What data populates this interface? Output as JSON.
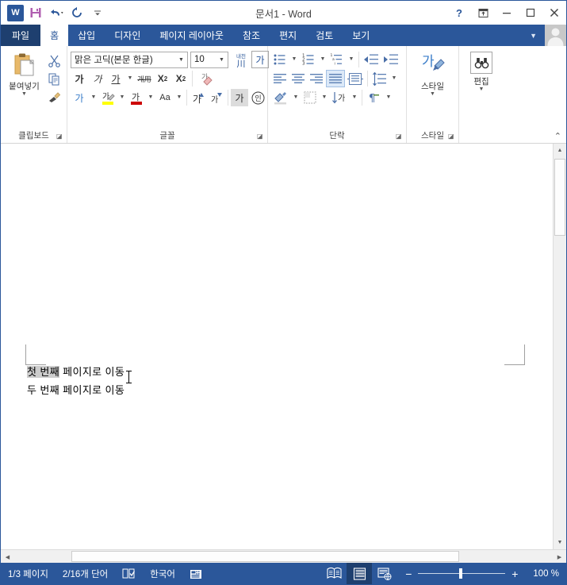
{
  "window": {
    "title": "문서1 - Word",
    "qat": [
      {
        "name": "word-logo",
        "label": "W"
      },
      {
        "name": "save",
        "label": "저장"
      },
      {
        "name": "undo",
        "label": "실행 취소"
      },
      {
        "name": "redo",
        "label": "다시 실행"
      },
      {
        "name": "customize-qat",
        "label": "빠른 실행 도구 모음 사용자 지정"
      }
    ],
    "controls": [
      {
        "name": "help",
        "glyph": "?"
      },
      {
        "name": "ribbon-display-options",
        "glyph": "⊼"
      },
      {
        "name": "minimize",
        "glyph": "—"
      },
      {
        "name": "maximize",
        "glyph": "□"
      },
      {
        "name": "close",
        "glyph": "✕"
      }
    ]
  },
  "tabs": {
    "file": "파일",
    "items": [
      {
        "label": "홈",
        "active": true
      },
      {
        "label": "삽입",
        "active": false
      },
      {
        "label": "디자인",
        "active": false
      },
      {
        "label": "페이지 레이아웃",
        "active": false
      },
      {
        "label": "참조",
        "active": false
      },
      {
        "label": "편지",
        "active": false
      },
      {
        "label": "검토",
        "active": false
      },
      {
        "label": "보기",
        "active": false
      }
    ]
  },
  "ribbon": {
    "collapse_label": "리본 메뉴 축소",
    "groups": {
      "clipboard": {
        "label": "클립보드",
        "paste": "붙여넣기",
        "cut": "잘라내기",
        "copy": "복사",
        "format_painter": "서식 복사"
      },
      "font": {
        "label": "글꼴",
        "font_name": "맑은 고딕(본문 한글)",
        "font_size": "10",
        "buttons": {
          "bold": "가",
          "italic": "가",
          "underline": "가",
          "strikethrough": "개用",
          "subscript": "X₂",
          "superscript": "X²",
          "clear_formatting": "서식 지우기",
          "text_effects": "가",
          "highlight": "가",
          "font_color": "가",
          "change_case": "Aa",
          "grow_font": "가",
          "shrink_font": "가",
          "phonetic_guide": "가",
          "enclose_characters": "인",
          "ruby": "내천"
        }
      },
      "paragraph": {
        "label": "단락",
        "buttons": {
          "bullets": "글머리 기호",
          "numbering": "번호 매기기",
          "multilevel": "다단계 목록",
          "decrease_indent": "내어쓰기",
          "increase_indent": "들여쓰기",
          "align_left": "왼쪽 맞춤",
          "align_center": "가운데 맞춤",
          "align_right": "오른쪽 맞춤",
          "justify": "양쪽 맞춤",
          "distribute": "균등 분할",
          "line_spacing": "줄 간격",
          "shading": "음영",
          "borders": "테두리",
          "sort": "정렬",
          "show_marks": "편집 기호 표시/숨기기"
        }
      },
      "styles": {
        "label": "스타일",
        "caption": "스타일"
      },
      "editing": {
        "label": "편집",
        "caption": "편집"
      }
    }
  },
  "document": {
    "lines": [
      {
        "selected_text": "첫 번째",
        "rest_text": " 페이지로 이동"
      },
      {
        "selected_text": "",
        "rest_text": "두 번째 페이지로 이동"
      }
    ]
  },
  "statusbar": {
    "page": "1/3 페이지",
    "words": "2/16개 단어",
    "proofing_icon": "proofing-errors-icon",
    "language": "한국어",
    "macro_icon": "macro-record-icon",
    "views": [
      {
        "name": "read-mode",
        "active": false
      },
      {
        "name": "print-layout",
        "active": true
      },
      {
        "name": "web-layout",
        "active": false
      }
    ],
    "zoom_out": "−",
    "zoom_in": "+",
    "zoom_level": "100 %"
  },
  "colors": {
    "accent": "#2b579a",
    "accent_dark": "#1e3f6f",
    "selection": "#cdcdcd",
    "tab_active_text": "#2b579a"
  }
}
